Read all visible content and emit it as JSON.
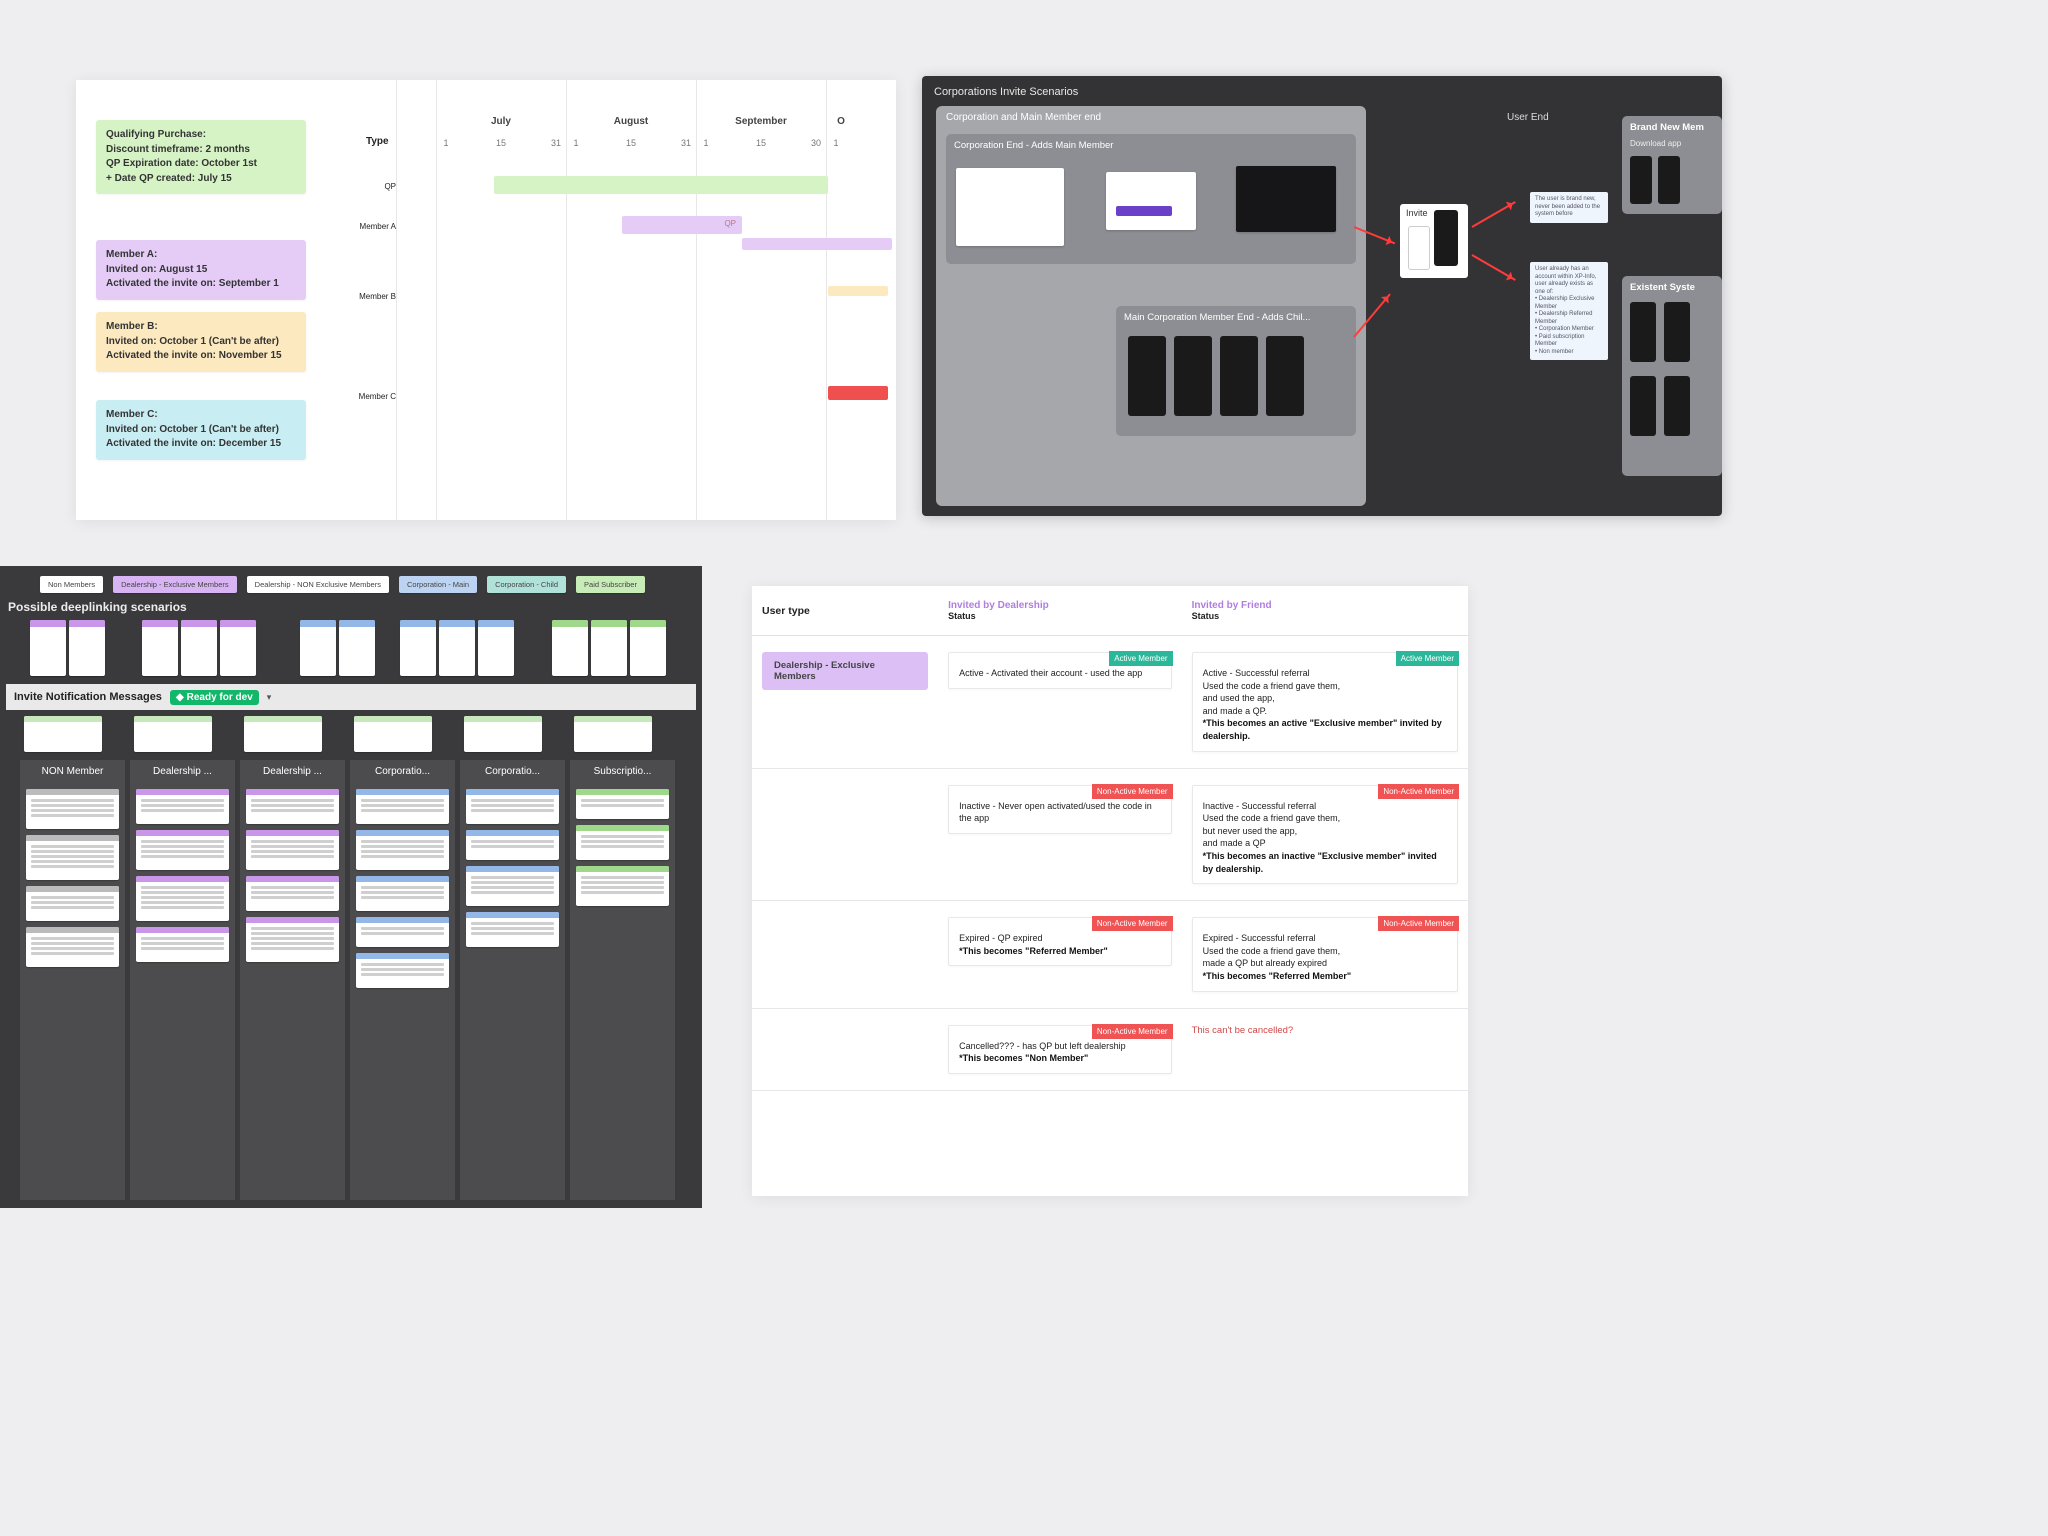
{
  "gantt": {
    "type_label": "Type",
    "months": [
      "July",
      "August",
      "September"
    ],
    "month_cutoff": "O",
    "days": [
      "1",
      "15",
      "31",
      "1",
      "15",
      "31",
      "1",
      "15",
      "30",
      "1"
    ],
    "rows": [
      "QP",
      "Member A",
      "Member B",
      "Member C"
    ],
    "qp_note": "Qualifying Purchase:\nDiscount timeframe: 2 months\nQP Expiration date: October 1st\n+ Date QP created: July 15",
    "member_a_note": "Member A:\nInvited on: August 15\nActivated the invite on: September 1",
    "member_b_note": "Member B:\nInvited on: October 1 (Can't be after)\nActivated the invite on: November 15",
    "member_c_note": "Member C:\nInvited on: October 1 (Can't be after)\nActivated the invite on: December 15",
    "qp_tag": "QP"
  },
  "flow": {
    "title": "Corporations Invite Scenarios",
    "group_corp": "Corporation and Main Member end",
    "group_user": "User End",
    "sub_corp_add_main": "Corporation End - Adds Main Member",
    "sub_main_add_child": "Main Corporation Member End - Adds Chil...",
    "brand_new": "Brand New Mem",
    "download_app": "Download app",
    "existent": "Existent Syste",
    "invite": "Invite",
    "note1": "The user is brand new, never been added to the system before",
    "note2": "User already has an account within XP-Info, user already exists as one of:\n• Dealership Exclusive Member\n• Dealership Referred Member\n• Corporation Member\n• Paid subscription Member\n• Non member"
  },
  "dark": {
    "tags": [
      "Non Members",
      "Dealership - Exclusive Members",
      "Dealership - NON Exclusive Members",
      "Corporation - Main",
      "Corporation - Child",
      "Paid Subscriber"
    ],
    "deeplinking_title": "Possible deeplinking scenarios",
    "invite_title": "Invite Notification Messages",
    "ready": "Ready for dev",
    "lanes": [
      "NON Member",
      "Dealership ...",
      "Dealership ...",
      "Corporatio...",
      "Corporatio...",
      "Subscriptio..."
    ]
  },
  "status": {
    "head_user": "User type",
    "head_ded": "Invited by Dealership",
    "head_fri": "Invited by Friend",
    "head_status": "Status",
    "user_chip": "Dealership - Exclusive Members",
    "active_badge": "Active Member",
    "nonactive_badge": "Non-Active Member",
    "ded_active": "Active - Activated their account - used the app",
    "fri_active": "Active - Successful referral\nUsed the code a friend gave them,\nand used the app,\nand made a QP.",
    "fri_active_bold": "*This becomes an active \"Exclusive member\" invited by dealership.",
    "ded_inactive": "Inactive - Never open activated/used the code in the app",
    "fri_inactive": "Inactive - Successful referral\nUsed the code a friend gave them,\nbut never used the app,\nand made a QP",
    "fri_inactive_bold": "*This becomes an inactive \"Exclusive member\" invited by dealership.",
    "ded_expired": "Expired - QP expired",
    "ded_expired_bold": "*This becomes \"Referred Member\"",
    "fri_expired": "Expired - Successful referral\nUsed the code a friend gave them,\nmade a QP but already expired",
    "fri_expired_bold": "*This becomes \"Referred Member\"",
    "ded_cancelled": "Cancelled??? - has QP but left dealership",
    "ded_cancelled_bold": "*This becomes \"Non Member\"",
    "fri_cancelled": "This can't be cancelled?"
  }
}
